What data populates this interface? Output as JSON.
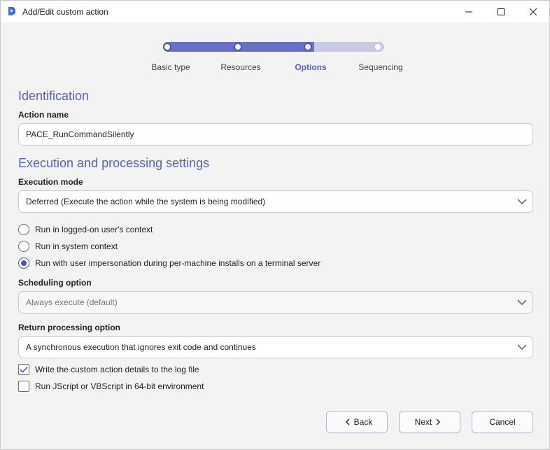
{
  "window": {
    "title": "Add/Edit custom action"
  },
  "stepper": {
    "steps": [
      {
        "label": "Basic type",
        "state": "done"
      },
      {
        "label": "Resources",
        "state": "done"
      },
      {
        "label": "Options",
        "state": "active"
      },
      {
        "label": "Sequencing",
        "state": "todo"
      }
    ],
    "progress": 0.68
  },
  "identification": {
    "heading": "Identification",
    "action_name_label": "Action name",
    "action_name_value": "PACE_RunCommandSilently"
  },
  "execution": {
    "heading": "Execution and processing settings",
    "mode_label": "Execution mode",
    "mode_value": "Deferred (Execute the action while the system is being modified)",
    "context_options": [
      {
        "label": "Run in logged-on user's context",
        "checked": false
      },
      {
        "label": "Run in system context",
        "checked": false
      },
      {
        "label": "Run with user impersonation during per-machine installs on a terminal server",
        "checked": true
      }
    ],
    "scheduling_label": "Scheduling option",
    "scheduling_value": "Always execute (default)",
    "return_label": "Return processing option",
    "return_value": "A synchronous execution that ignores exit code and continues",
    "checkboxes": [
      {
        "label": "Write the custom action details to the log file",
        "checked": true
      },
      {
        "label": "Run JScript or VBScript in 64-bit environment",
        "checked": false
      }
    ]
  },
  "buttons": {
    "back": "Back",
    "next": "Next",
    "cancel": "Cancel"
  },
  "colors": {
    "accent": "#5c61bf",
    "track_fill": "#6b6fc5",
    "track_bg": "#c8c9e4"
  }
}
